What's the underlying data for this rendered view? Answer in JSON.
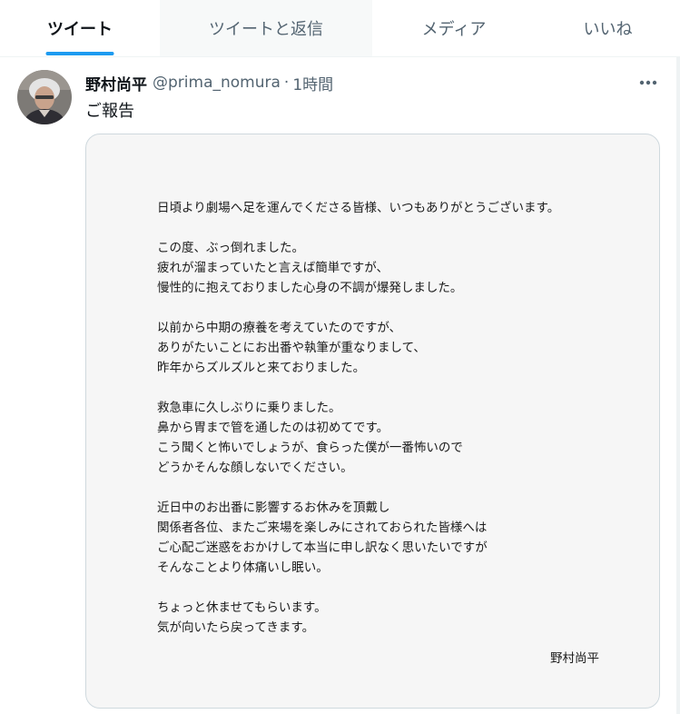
{
  "tabs": [
    {
      "label": "ツイート",
      "active": true
    },
    {
      "label": "ツイートと返信",
      "active": false
    },
    {
      "label": "メディア",
      "active": false
    },
    {
      "label": "いいね",
      "active": false
    }
  ],
  "tweet": {
    "author_name": "野村尚平",
    "handle": "@prima_nomura",
    "separator": "·",
    "time": "1時間",
    "text": "ご報告",
    "more_icon": "more-horizontal-icon"
  },
  "letter": {
    "paragraphs": [
      [
        "日頃より劇場へ足を運んでくださる皆様、いつもありがとうございます。"
      ],
      [
        "この度、ぶっ倒れました。",
        "疲れが溜まっていたと言えば簡単ですが、",
        "慢性的に抱えておりました心身の不調が爆発しました。"
      ],
      [
        "以前から中期の療養を考えていたのですが、",
        "ありがたいことにお出番や執筆が重なりまして、",
        "昨年からズルズルと来ておりました。"
      ],
      [
        "救急車に久しぶりに乗りました。",
        "鼻から胃まで管を通したのは初めてです。",
        "こう聞くと怖いでしょうが、食らった僕が一番怖いので",
        "どうかそんな顔しないでください。"
      ],
      [
        "近日中のお出番に影響するお休みを頂戴し",
        "関係者各位、またご来場を楽しみにされておられた皆様へは",
        "ご心配ご迷惑をおかけして本当に申し訳なく思いたいですが",
        "そんなことより体痛いし眠い。"
      ],
      [
        "ちょっと休ませてもらいます。",
        "気が向いたら戻ってきます。"
      ]
    ],
    "signature": "野村尚平"
  },
  "colors": {
    "accent": "#1d9bf0",
    "text_primary": "#0f1419",
    "text_secondary": "#536471"
  }
}
